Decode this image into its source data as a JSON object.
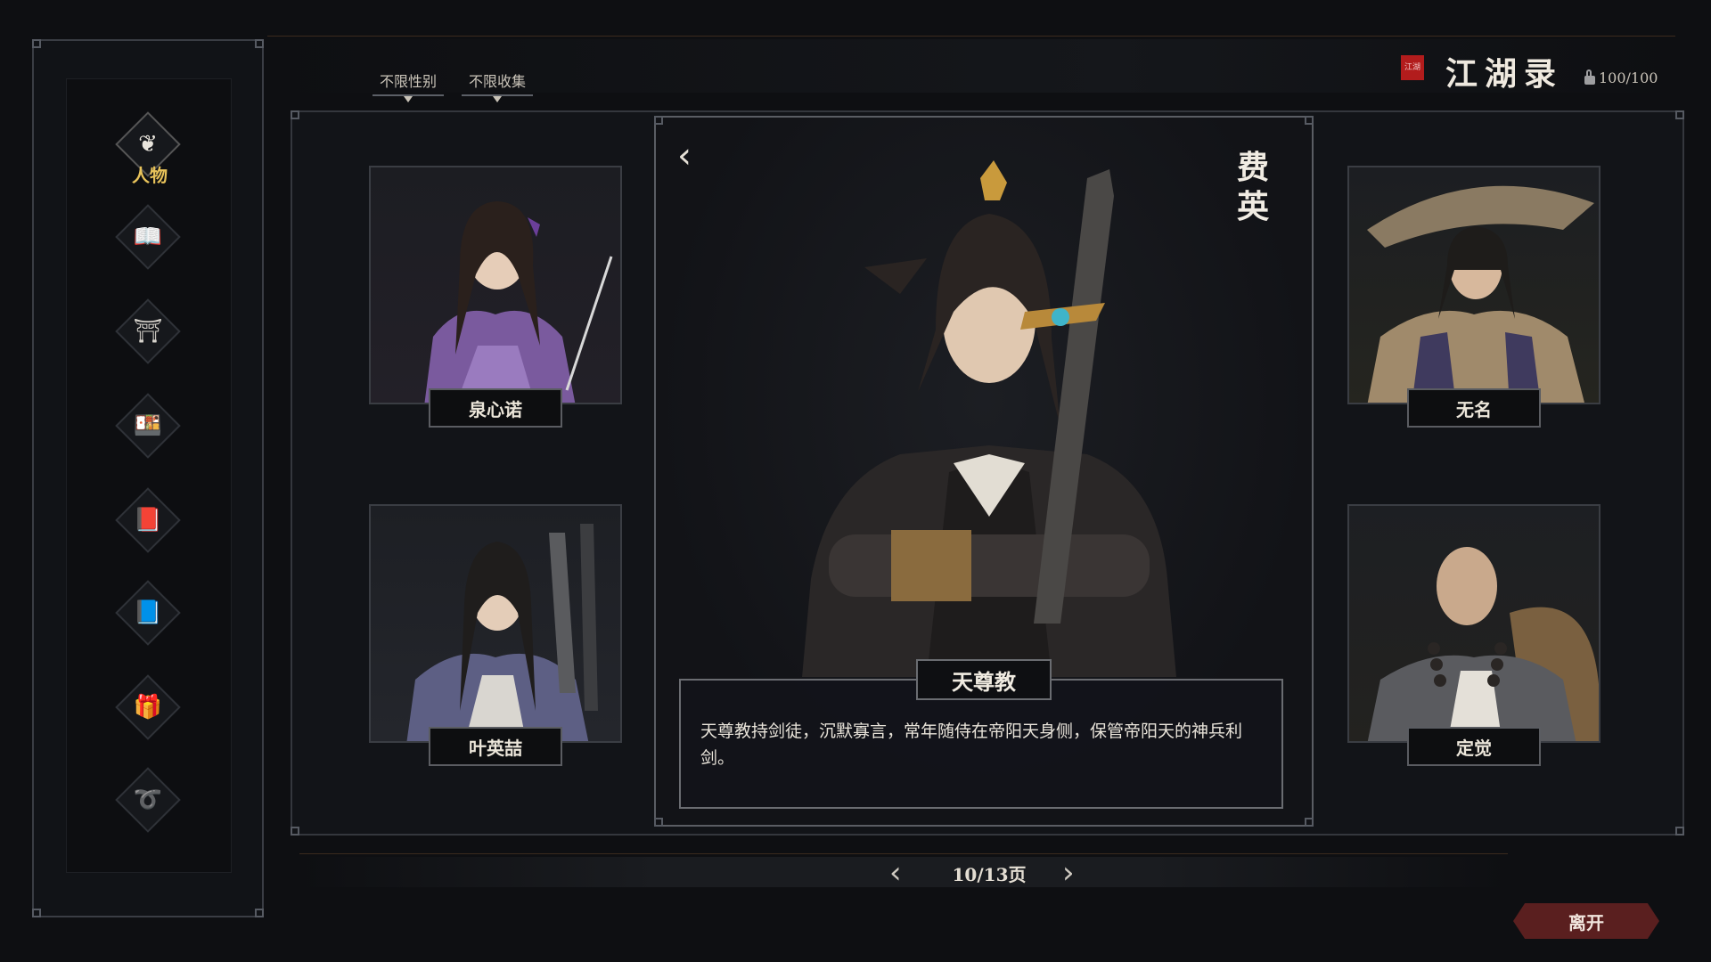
{
  "header": {
    "filters": [
      {
        "label": "不限性别"
      },
      {
        "label": "不限收集"
      }
    ],
    "seal_text": "江湖",
    "title": "江湖录",
    "collection_count": "100/100"
  },
  "sidebar": {
    "items": [
      {
        "label": "人物",
        "icon": "character-icon",
        "glyph": "❦"
      },
      {
        "icon": "scroll-icon",
        "glyph": "📖"
      },
      {
        "icon": "building-icon",
        "glyph": "⛩"
      },
      {
        "icon": "food-icon",
        "glyph": "🍱"
      },
      {
        "icon": "book-icon",
        "glyph": "📕"
      },
      {
        "icon": "manual-icon",
        "glyph": "📘"
      },
      {
        "icon": "item-icon",
        "glyph": "🎁"
      },
      {
        "icon": "creature-icon",
        "glyph": "➰"
      }
    ]
  },
  "characters": {
    "left_top": {
      "name": "泉心诺"
    },
    "left_bottom": {
      "name": "叶英喆"
    },
    "right_top": {
      "name": "无名"
    },
    "right_bottom": {
      "name": "定觉"
    }
  },
  "detail": {
    "back_glyph": "‹",
    "name": "费英",
    "faction": "天尊教",
    "description": "天尊教持剑徒，沉默寡言，常年随侍在帝阳天身侧，保管帝阳天的神兵利剑。"
  },
  "pager": {
    "prev_glyph": "‹",
    "next_glyph": "›",
    "page_text": "10/13页"
  },
  "leave_label": "离开",
  "colors": {
    "accent_gold": "#e8c35a",
    "seal_red": "#b21c1c",
    "leave_button": "#5a1f1f"
  }
}
